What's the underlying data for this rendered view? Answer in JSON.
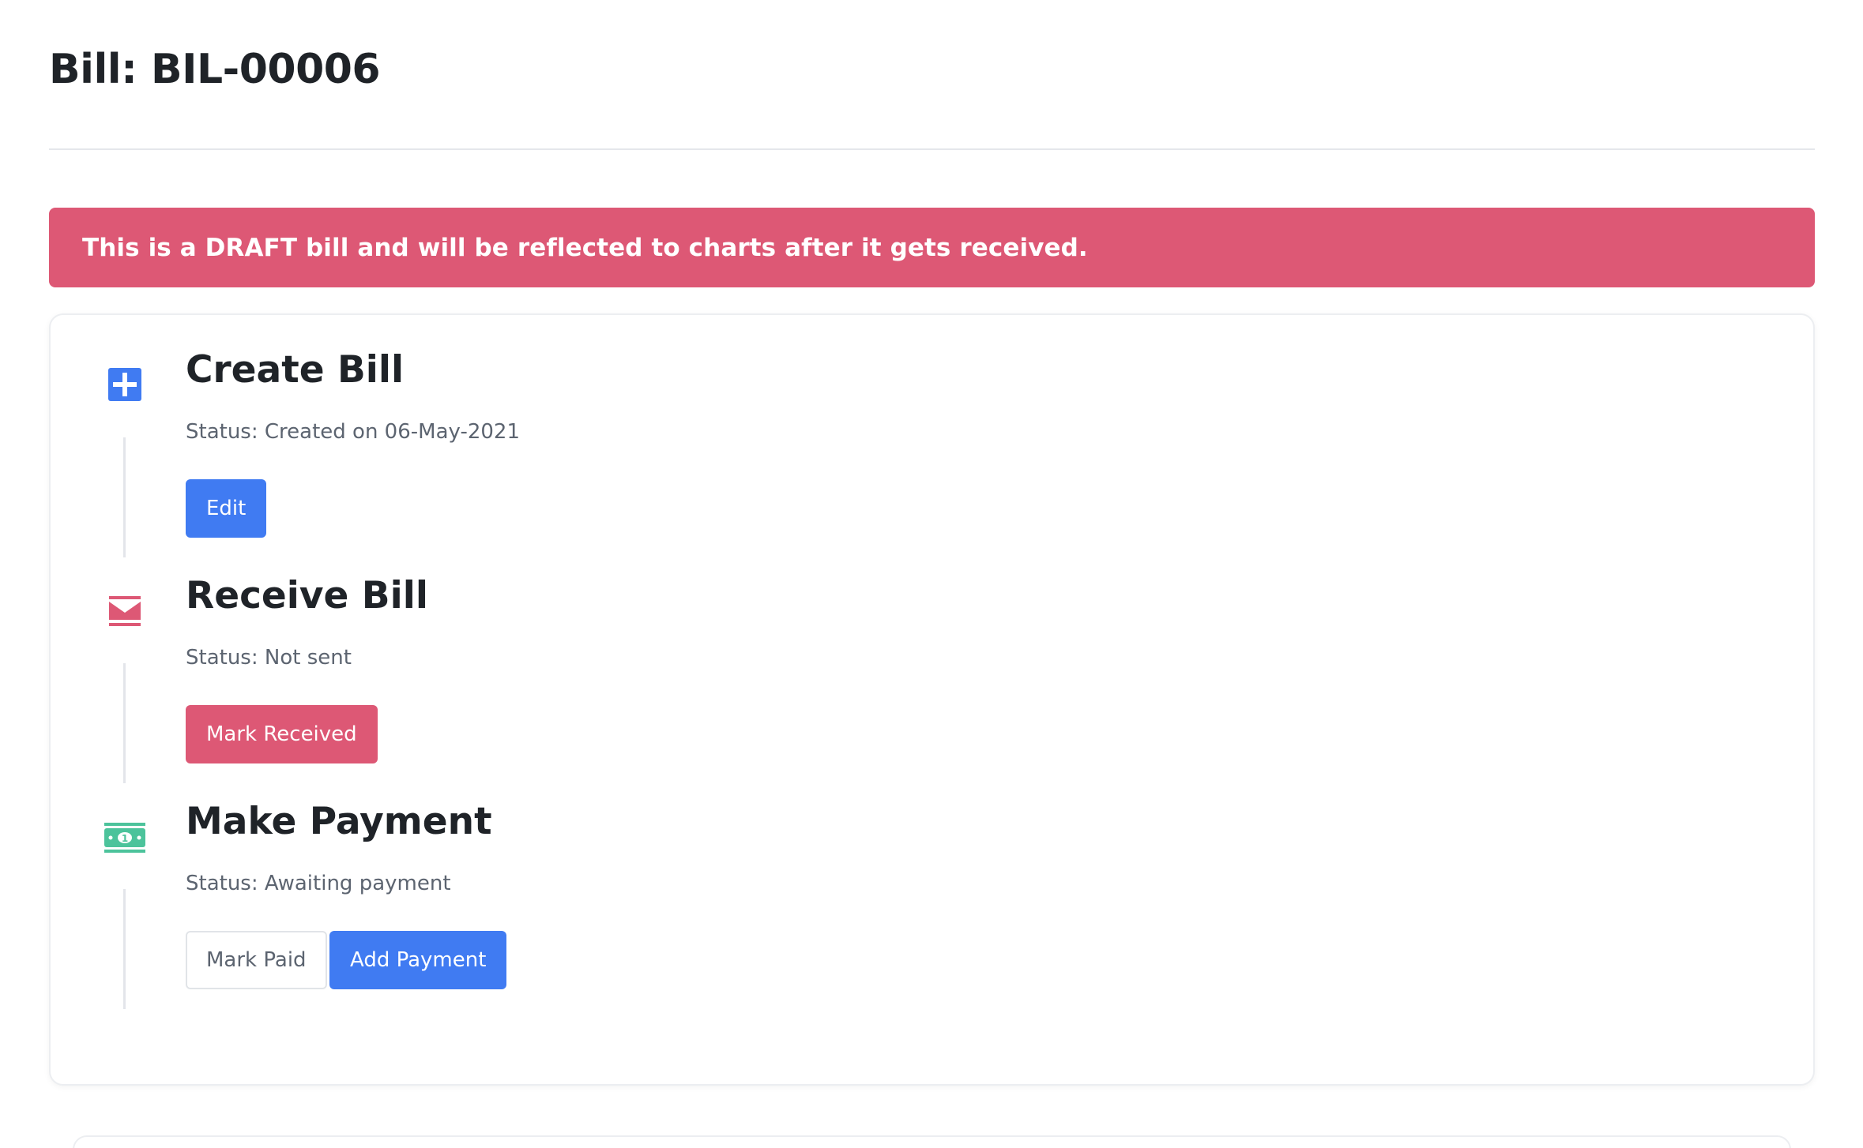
{
  "page": {
    "title": "Bill: BIL-00006"
  },
  "alert": {
    "text": "This is a DRAFT bill and will be reflected to charts after it gets received.",
    "color": "#dd5875"
  },
  "steps": [
    {
      "icon": "plus-square-icon",
      "icon_color": "#407bf2",
      "title": "Create Bill",
      "status": "Status: Created on 06-May-2021",
      "buttons": [
        {
          "label": "Edit",
          "style": "primary"
        }
      ]
    },
    {
      "icon": "envelope-icon",
      "icon_color": "#dd5875",
      "title": "Receive Bill",
      "status": "Status: Not sent",
      "buttons": [
        {
          "label": "Mark Received",
          "style": "danger"
        }
      ]
    },
    {
      "icon": "money-bill-icon",
      "icon_color": "#4cc39b",
      "title": "Make Payment",
      "status": "Status: Awaiting payment",
      "buttons": [
        {
          "label": "Mark Paid",
          "style": "outline"
        },
        {
          "label": "Add Payment",
          "style": "primary"
        }
      ]
    }
  ],
  "colors": {
    "primary": "#407bf2",
    "danger": "#dd5875",
    "success": "#4cc39b",
    "text": "#1f2328",
    "muted": "#5c6470"
  }
}
